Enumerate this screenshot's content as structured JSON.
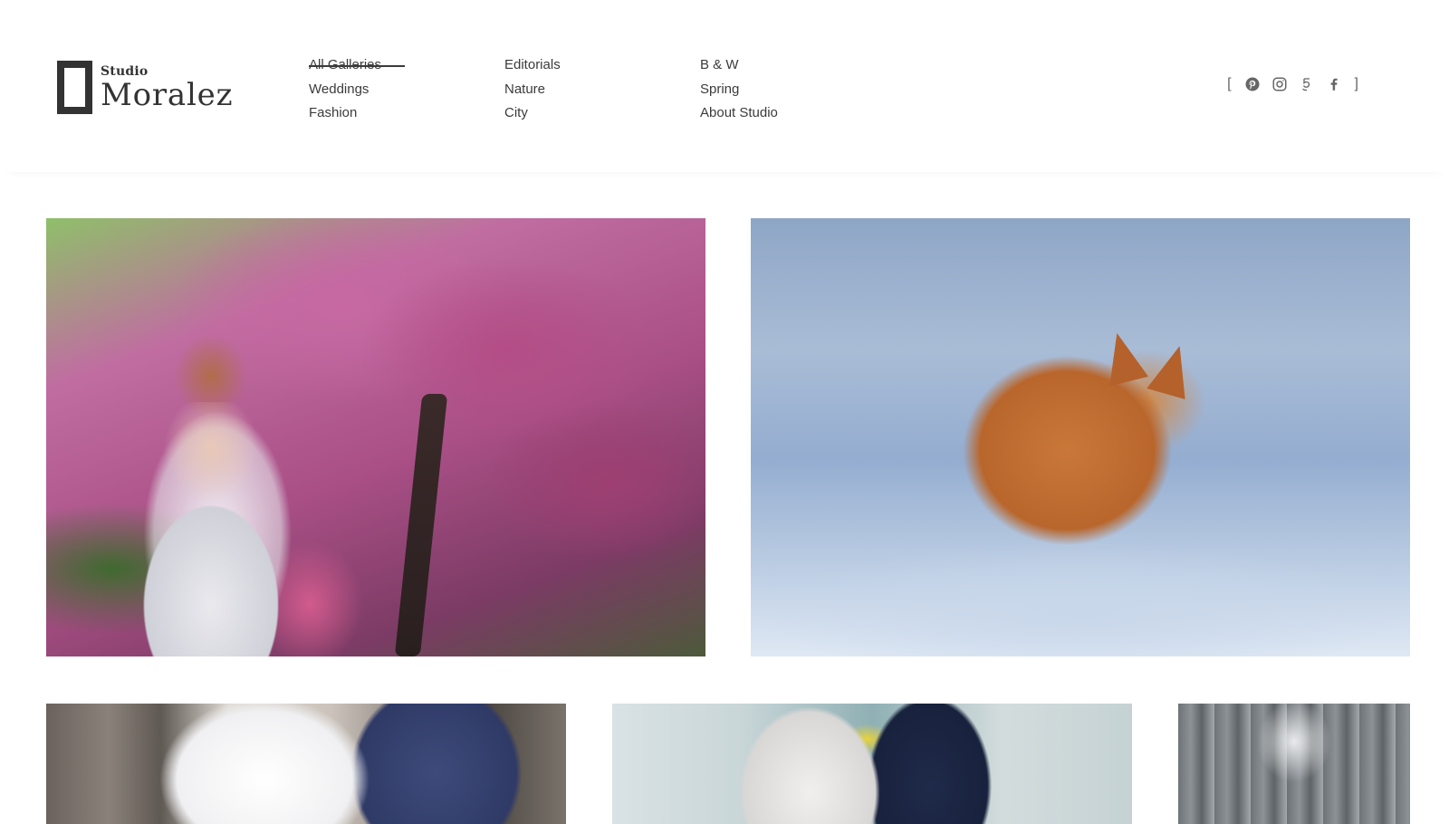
{
  "brand": {
    "small": "Studio",
    "big": "Moralez"
  },
  "nav": {
    "columns": [
      [
        {
          "label": "All Galleries",
          "active": true
        },
        {
          "label": "Weddings"
        },
        {
          "label": "Fashion"
        }
      ],
      [
        {
          "label": "Editorials"
        },
        {
          "label": "Nature"
        },
        {
          "label": "City"
        }
      ],
      [
        {
          "label": "B & W"
        },
        {
          "label": "Spring"
        },
        {
          "label": "About Studio"
        }
      ]
    ]
  },
  "social": {
    "open_bracket": "[",
    "close_bracket": "]",
    "icons": [
      "pinterest-icon",
      "instagram-icon",
      "500px-icon",
      "facebook-icon"
    ]
  },
  "gallery": {
    "photos": [
      {
        "subject": "bride-under-blossom-tree"
      },
      {
        "subject": "red-fox-in-snow"
      },
      {
        "subject": "couple-wedding-dress-suit"
      },
      {
        "subject": "couple-walking-street"
      },
      {
        "subject": "snowy-forest"
      }
    ]
  },
  "colors": {
    "text": "#3b3b3b",
    "logo": "#333333",
    "background": "#ffffff"
  }
}
